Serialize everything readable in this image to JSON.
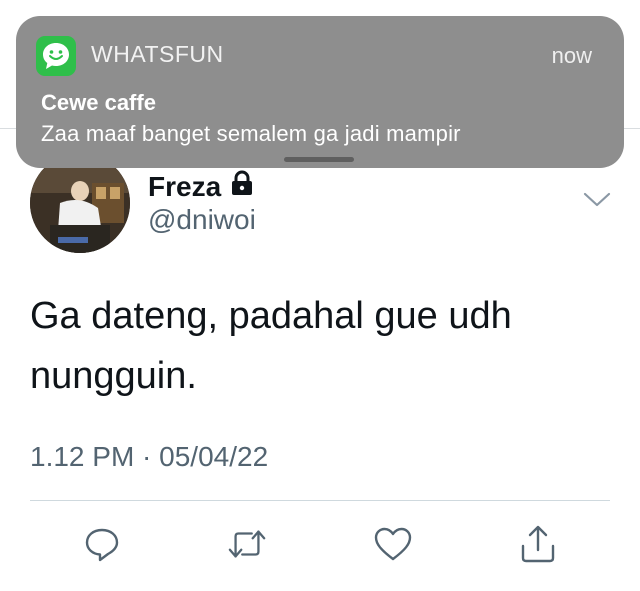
{
  "notification": {
    "app_name": "WHATSFUN",
    "time": "now",
    "title": "Cewe caffe",
    "body": "Zaa maaf banget semalem ga jadi mampir",
    "icon": "whatsapp-smile-icon",
    "icon_color": "#2fbf4a"
  },
  "tweet": {
    "author_name": "Freza",
    "handle": "@dniwoi",
    "protected_icon": "lock-icon",
    "text": "Ga dateng, padahal gue udh nungguin.",
    "timestamp": "1.12 PM · 05/04/22"
  },
  "actions": [
    {
      "name": "reply",
      "icon": "reply-icon"
    },
    {
      "name": "retweet",
      "icon": "retweet-icon"
    },
    {
      "name": "like",
      "icon": "heart-icon"
    },
    {
      "name": "share",
      "icon": "share-icon"
    }
  ],
  "colors": {
    "secondary_text": "#536471",
    "notification_bg": "#8e8e8e"
  }
}
